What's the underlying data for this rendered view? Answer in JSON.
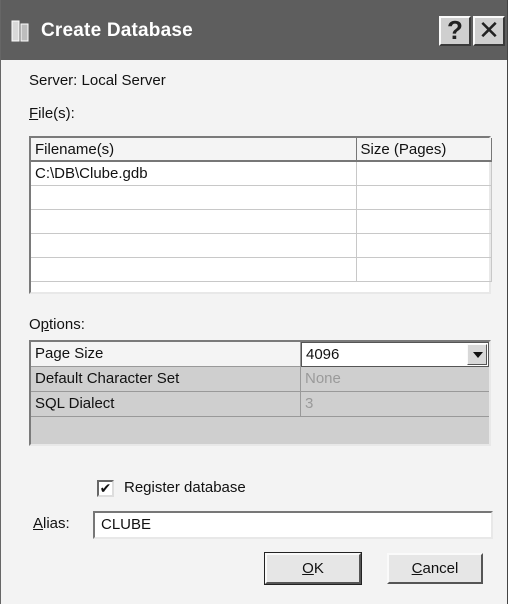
{
  "window": {
    "title": "Create Database"
  },
  "server_label": "Server: Local Server",
  "files": {
    "label": "File(s):",
    "columns": [
      "Filename(s)",
      "Size (Pages)"
    ],
    "rows": [
      [
        "C:\\DB\\Clube.gdb",
        ""
      ],
      [
        "",
        ""
      ],
      [
        "",
        ""
      ],
      [
        "",
        ""
      ],
      [
        "",
        ""
      ]
    ]
  },
  "options": {
    "label": "Options:",
    "rows": [
      {
        "name": "Page Size",
        "value": "4096"
      },
      {
        "name": "Default Character Set",
        "value": "None"
      },
      {
        "name": "SQL Dialect",
        "value": "3"
      }
    ]
  },
  "register_database": {
    "label": "Register database",
    "checked": true,
    "mark": "✔"
  },
  "alias": {
    "label": "Alias:",
    "value": "CLUBE"
  },
  "buttons": {
    "ok": "OK",
    "cancel": "Cancel"
  },
  "titlebar_buttons": {
    "help": "?",
    "close": "✕"
  }
}
